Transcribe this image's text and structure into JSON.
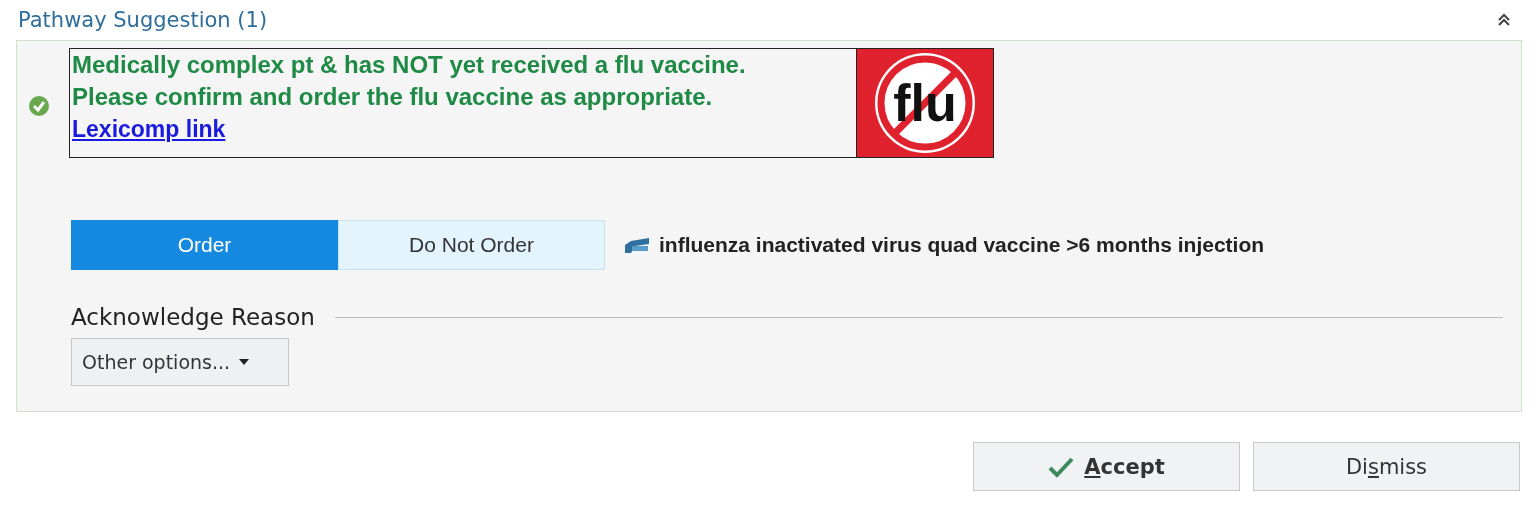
{
  "section": {
    "title": "Pathway Suggestion (1)",
    "expanded": true
  },
  "suggestion": {
    "accepted": true,
    "message_lines": [
      "Medically complex pt & has NOT yet received a flu vaccine.",
      "Please confirm and order the flu vaccine as appropriate."
    ],
    "link": "Lexicomp link",
    "logo_text": "flu"
  },
  "order_toggle": [
    {
      "label": "Order",
      "selected": true
    },
    {
      "label": "Do Not Order",
      "selected": false
    }
  ],
  "medication": "influenza inactivated virus quad vaccine >6 months injection",
  "acknowledge": {
    "heading": "Acknowledge Reason",
    "dropdown": "Other options..."
  },
  "buttons": [
    {
      "kind": "accept",
      "key": "A",
      "after": "ccept"
    },
    {
      "kind": "dismiss",
      "before": "Di",
      "key": "s",
      "after": "miss"
    }
  ]
}
